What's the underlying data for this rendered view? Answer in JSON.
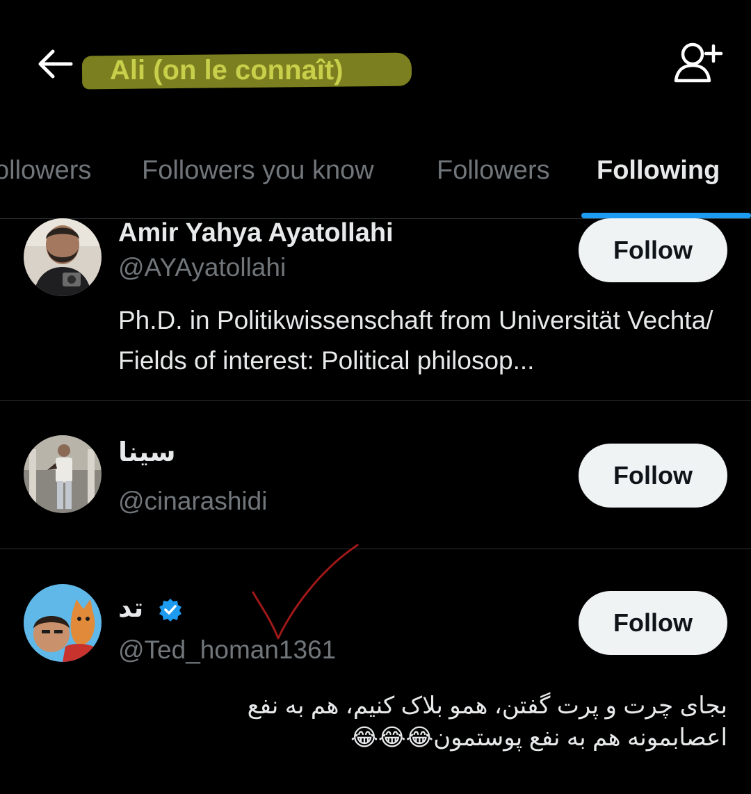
{
  "header": {
    "title": "Ali (on le connaît)",
    "back_icon": "arrow-left-icon",
    "add_user_icon": "person-plus-icon"
  },
  "tabs": [
    {
      "label": "ollowers",
      "active": false
    },
    {
      "label": "Followers you know",
      "active": false
    },
    {
      "label": "Followers",
      "active": false
    },
    {
      "label": "Following",
      "active": true
    }
  ],
  "users": [
    {
      "name": "Amir Yahya Ayatollahi",
      "handle": "@AYAyatollahi",
      "bio": "Ph.D. in Politikwissenschaft from Universität Vechta/ Fields of interest: Political philosop...",
      "follow_label": "Follow",
      "verified": false
    },
    {
      "name": "سینا",
      "handle": "@cinarashidi",
      "bio": "",
      "follow_label": "Follow",
      "verified": false
    },
    {
      "name": "تد",
      "handle": "@Ted_homan1361",
      "bio": "بجای چرت و پرت گفتن، همو بلاک کنیم، هم به نفع اعصابمونه هم به نفع پوستمون😂😂😂",
      "follow_label": "Follow",
      "verified": true
    }
  ],
  "colors": {
    "background": "#000000",
    "accent": "#1d9bf0",
    "highlight": "#7b7f1f",
    "annotation": "#a01818"
  }
}
